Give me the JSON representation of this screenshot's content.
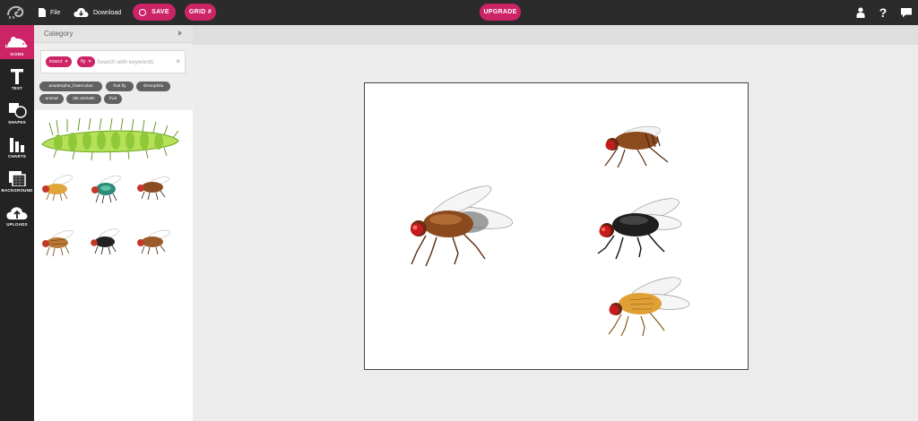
{
  "topbar": {
    "file_label": "File",
    "download_label": "Download",
    "save_label": "SAVE",
    "grid_label": "GRID #",
    "upgrade_label": "UPGRADE",
    "help_label": "?"
  },
  "sidebar": {
    "items": [
      {
        "label": "ICONS",
        "icon": "mouse-icon",
        "active": true
      },
      {
        "label": "TEXT",
        "icon": "text-icon",
        "active": false
      },
      {
        "label": "SHAPES",
        "icon": "shapes-icon",
        "active": false
      },
      {
        "label": "CHARTS",
        "icon": "bar-chart-icon",
        "active": false
      },
      {
        "label": "BACKGROUND",
        "icon": "background-icon",
        "active": false
      },
      {
        "label": "UPLOADS",
        "icon": "cloud-upload-icon",
        "active": false
      }
    ]
  },
  "panel": {
    "category_label": "Category",
    "search": {
      "chips": [
        "insect",
        "fly"
      ],
      "chip_remove": "×",
      "placeholder": "Search with keywords",
      "clear": "×"
    },
    "tags": [
      "anastrepha_fraterculus",
      "fruit fly",
      "drosophila",
      "animal",
      "lab animals",
      "fruit"
    ]
  },
  "colors": {
    "accent": "#cc2466",
    "topbar": "#2b2b2b",
    "rail": "#232323",
    "tag": "#616161"
  }
}
